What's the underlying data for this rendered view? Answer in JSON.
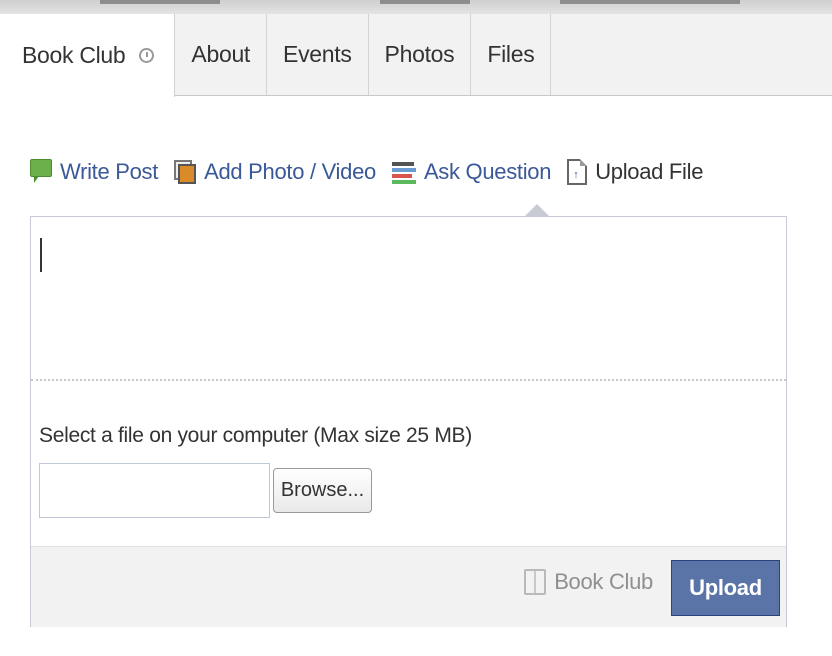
{
  "tabs": [
    {
      "label": "Book Club",
      "active": true,
      "icon": "clock-icon"
    },
    {
      "label": "About",
      "active": false
    },
    {
      "label": "Events",
      "active": false
    },
    {
      "label": "Photos",
      "active": false
    },
    {
      "label": "Files",
      "active": false
    }
  ],
  "composer": {
    "actions": [
      {
        "label": "Write Post",
        "icon": "speech-bubble-icon",
        "selected": false
      },
      {
        "label": "Add Photo / Video",
        "icon": "photo-icon",
        "selected": false
      },
      {
        "label": "Ask Question",
        "icon": "question-icon",
        "selected": false
      },
      {
        "label": "Upload File",
        "icon": "document-upload-icon",
        "selected": true
      }
    ],
    "message_value": "",
    "file_label": "Select a file on your computer (Max size 25 MB)",
    "file_input_value": "",
    "browse_label": "Browse...",
    "audience_label": "Book Club",
    "audience_icon": "book-icon",
    "upload_label": "Upload"
  },
  "colors": {
    "link_blue": "#3b5998",
    "button_blue": "#5b74a8",
    "tab_bar_bg": "#f2f2f2",
    "footer_bg": "#f2f2f2",
    "post_icon_green": "#6bb04a"
  }
}
